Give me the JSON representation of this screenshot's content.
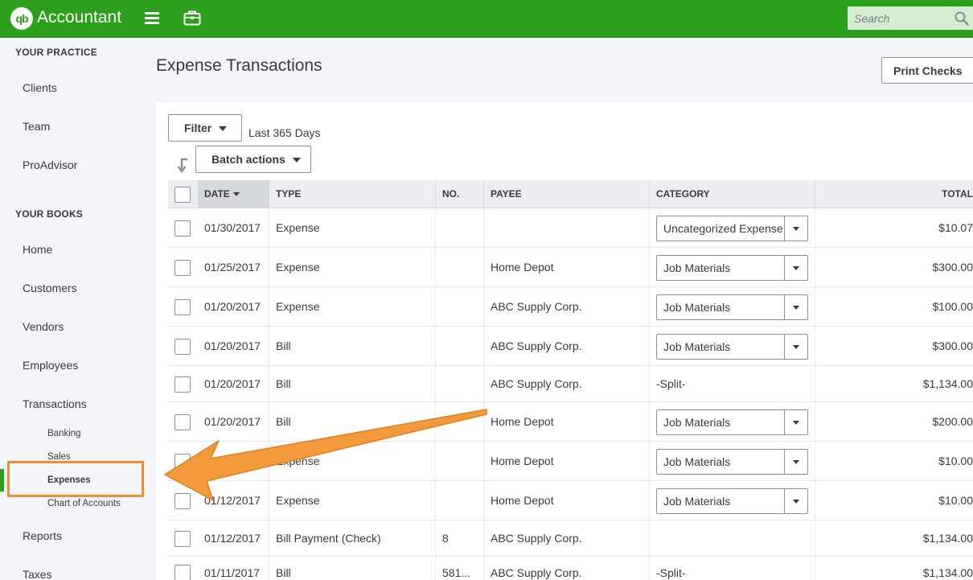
{
  "app": {
    "brand": "Accountant",
    "logo_text": "qb"
  },
  "search": {
    "placeholder": "Search"
  },
  "sidebar": {
    "practice_heading": "YOUR PRACTICE",
    "practice_items": [
      "Clients",
      "Team",
      "ProAdvisor"
    ],
    "books_heading": "YOUR BOOKS",
    "books_items": [
      "Home",
      "Customers",
      "Vendors",
      "Employees",
      "Transactions"
    ],
    "transaction_sub": [
      "Banking",
      "Sales",
      "Expenses",
      "Chart of Accounts"
    ],
    "after_items": [
      "Reports",
      "Taxes"
    ]
  },
  "page": {
    "title": "Expense Transactions",
    "print_checks": "Print Checks",
    "filter_label": "Filter",
    "filter_range": "Last 365 Days",
    "batch_label": "Batch actions"
  },
  "table": {
    "headers": {
      "date": "DATE",
      "type": "TYPE",
      "no": "NO.",
      "payee": "PAYEE",
      "category": "CATEGORY",
      "total": "TOTAL"
    },
    "rows": [
      {
        "date": "01/30/2017",
        "type": "Expense",
        "no": "",
        "payee": "",
        "category": "Uncategorized Expense",
        "select": true,
        "total": "$10.07"
      },
      {
        "date": "01/25/2017",
        "type": "Expense",
        "no": "",
        "payee": "Home Depot",
        "category": "Job Materials",
        "select": true,
        "total": "$300.00"
      },
      {
        "date": "01/20/2017",
        "type": "Expense",
        "no": "",
        "payee": "ABC Supply Corp.",
        "category": "Job Materials",
        "select": true,
        "total": "$100.00"
      },
      {
        "date": "01/20/2017",
        "type": "Bill",
        "no": "",
        "payee": "ABC Supply Corp.",
        "category": "Job Materials",
        "select": true,
        "total": "$300.00"
      },
      {
        "date": "01/20/2017",
        "type": "Bill",
        "no": "",
        "payee": "ABC Supply Corp.",
        "category": "-Split-",
        "select": false,
        "total": "$1,134.00"
      },
      {
        "date": "01/20/2017",
        "type": "Bill",
        "no": "",
        "payee": "Home Depot",
        "category": "Job Materials",
        "select": true,
        "total": "$200.00"
      },
      {
        "date": "",
        "type": "Expense",
        "no": "",
        "payee": "Home Depot",
        "category": "Job Materials",
        "select": true,
        "total": "$10.00"
      },
      {
        "date": "01/12/2017",
        "type": "Expense",
        "no": "",
        "payee": "Home Depot",
        "category": "Job Materials",
        "select": true,
        "total": "$10.00"
      },
      {
        "date": "01/12/2017",
        "type": "Bill Payment (Check)",
        "no": "8",
        "payee": "ABC Supply Corp.",
        "category": "",
        "select": false,
        "total": "$1,134.00"
      },
      {
        "date": "01/11/2017",
        "type": "Bill",
        "no": "581...",
        "payee": "ABC Supply Corp.",
        "category": "-Split-",
        "select": false,
        "total": "$1,134.00"
      }
    ]
  },
  "colors": {
    "brand_green": "#2ca01c",
    "highlight_orange": "#f08c33"
  }
}
